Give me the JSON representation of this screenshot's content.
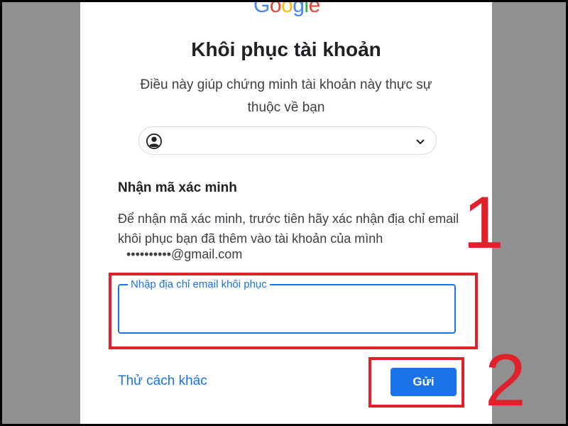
{
  "brand": {
    "logo_letters": [
      {
        "ch": "G",
        "color": "#4285F4"
      },
      {
        "ch": "o",
        "color": "#EA4335"
      },
      {
        "ch": "o",
        "color": "#FBBC05"
      },
      {
        "ch": "g",
        "color": "#4285F4"
      },
      {
        "ch": "l",
        "color": "#34A853"
      },
      {
        "ch": "e",
        "color": "#EA4335"
      }
    ]
  },
  "page": {
    "title": "Khôi phục tài khoản",
    "subtitle": "Điều này giúp chứng minh tài khoản này thực sự thuộc về bạn"
  },
  "account_chip": {
    "icon": "account-circle-icon",
    "dropdown_icon": "chevron-down-icon"
  },
  "verification": {
    "heading": "Nhận mã xác minh",
    "description": "Để nhận mã xác minh, trước tiên hãy xác nhận địa chỉ email khôi phục bạn đã thêm vào tài khoản của mình",
    "masked_email": "••••••••••@gmail.com"
  },
  "recovery_input": {
    "label": "Nhập địa chỉ email khôi phục",
    "value": ""
  },
  "actions": {
    "try_another_way": "Thử cách khác",
    "send": "Gửi"
  },
  "annotations": {
    "step1": "1",
    "step2": "2",
    "highlight_color": "#e0202a"
  },
  "colors": {
    "accent": "#1a73e8",
    "background": "#909090",
    "card": "#ffffff"
  }
}
